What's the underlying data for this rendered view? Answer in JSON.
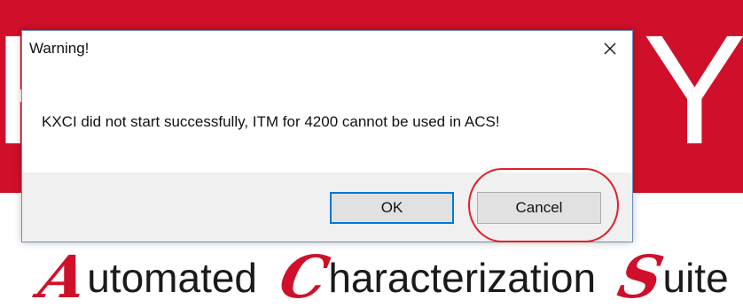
{
  "background_app": {
    "brand_left_letter": "K",
    "brand_right_letter": "Y",
    "tagline_words": [
      {
        "cap": "A",
        "rest": "utomated"
      },
      {
        "cap": "C",
        "rest": "haracterization"
      },
      {
        "cap": "S",
        "rest": "uite"
      }
    ],
    "brand_color": "#d0102a"
  },
  "dialog": {
    "title": "Warning!",
    "close_icon": "close-icon",
    "message": "KXCI did not start successfully, ITM for 4200 cannot be used in ACS!",
    "buttons": {
      "ok_label": "OK",
      "cancel_label": "Cancel"
    },
    "focus_color": "#0078d7"
  },
  "annotation": {
    "shape": "ellipse",
    "target": "cancel-button",
    "color": "#e0202a"
  }
}
